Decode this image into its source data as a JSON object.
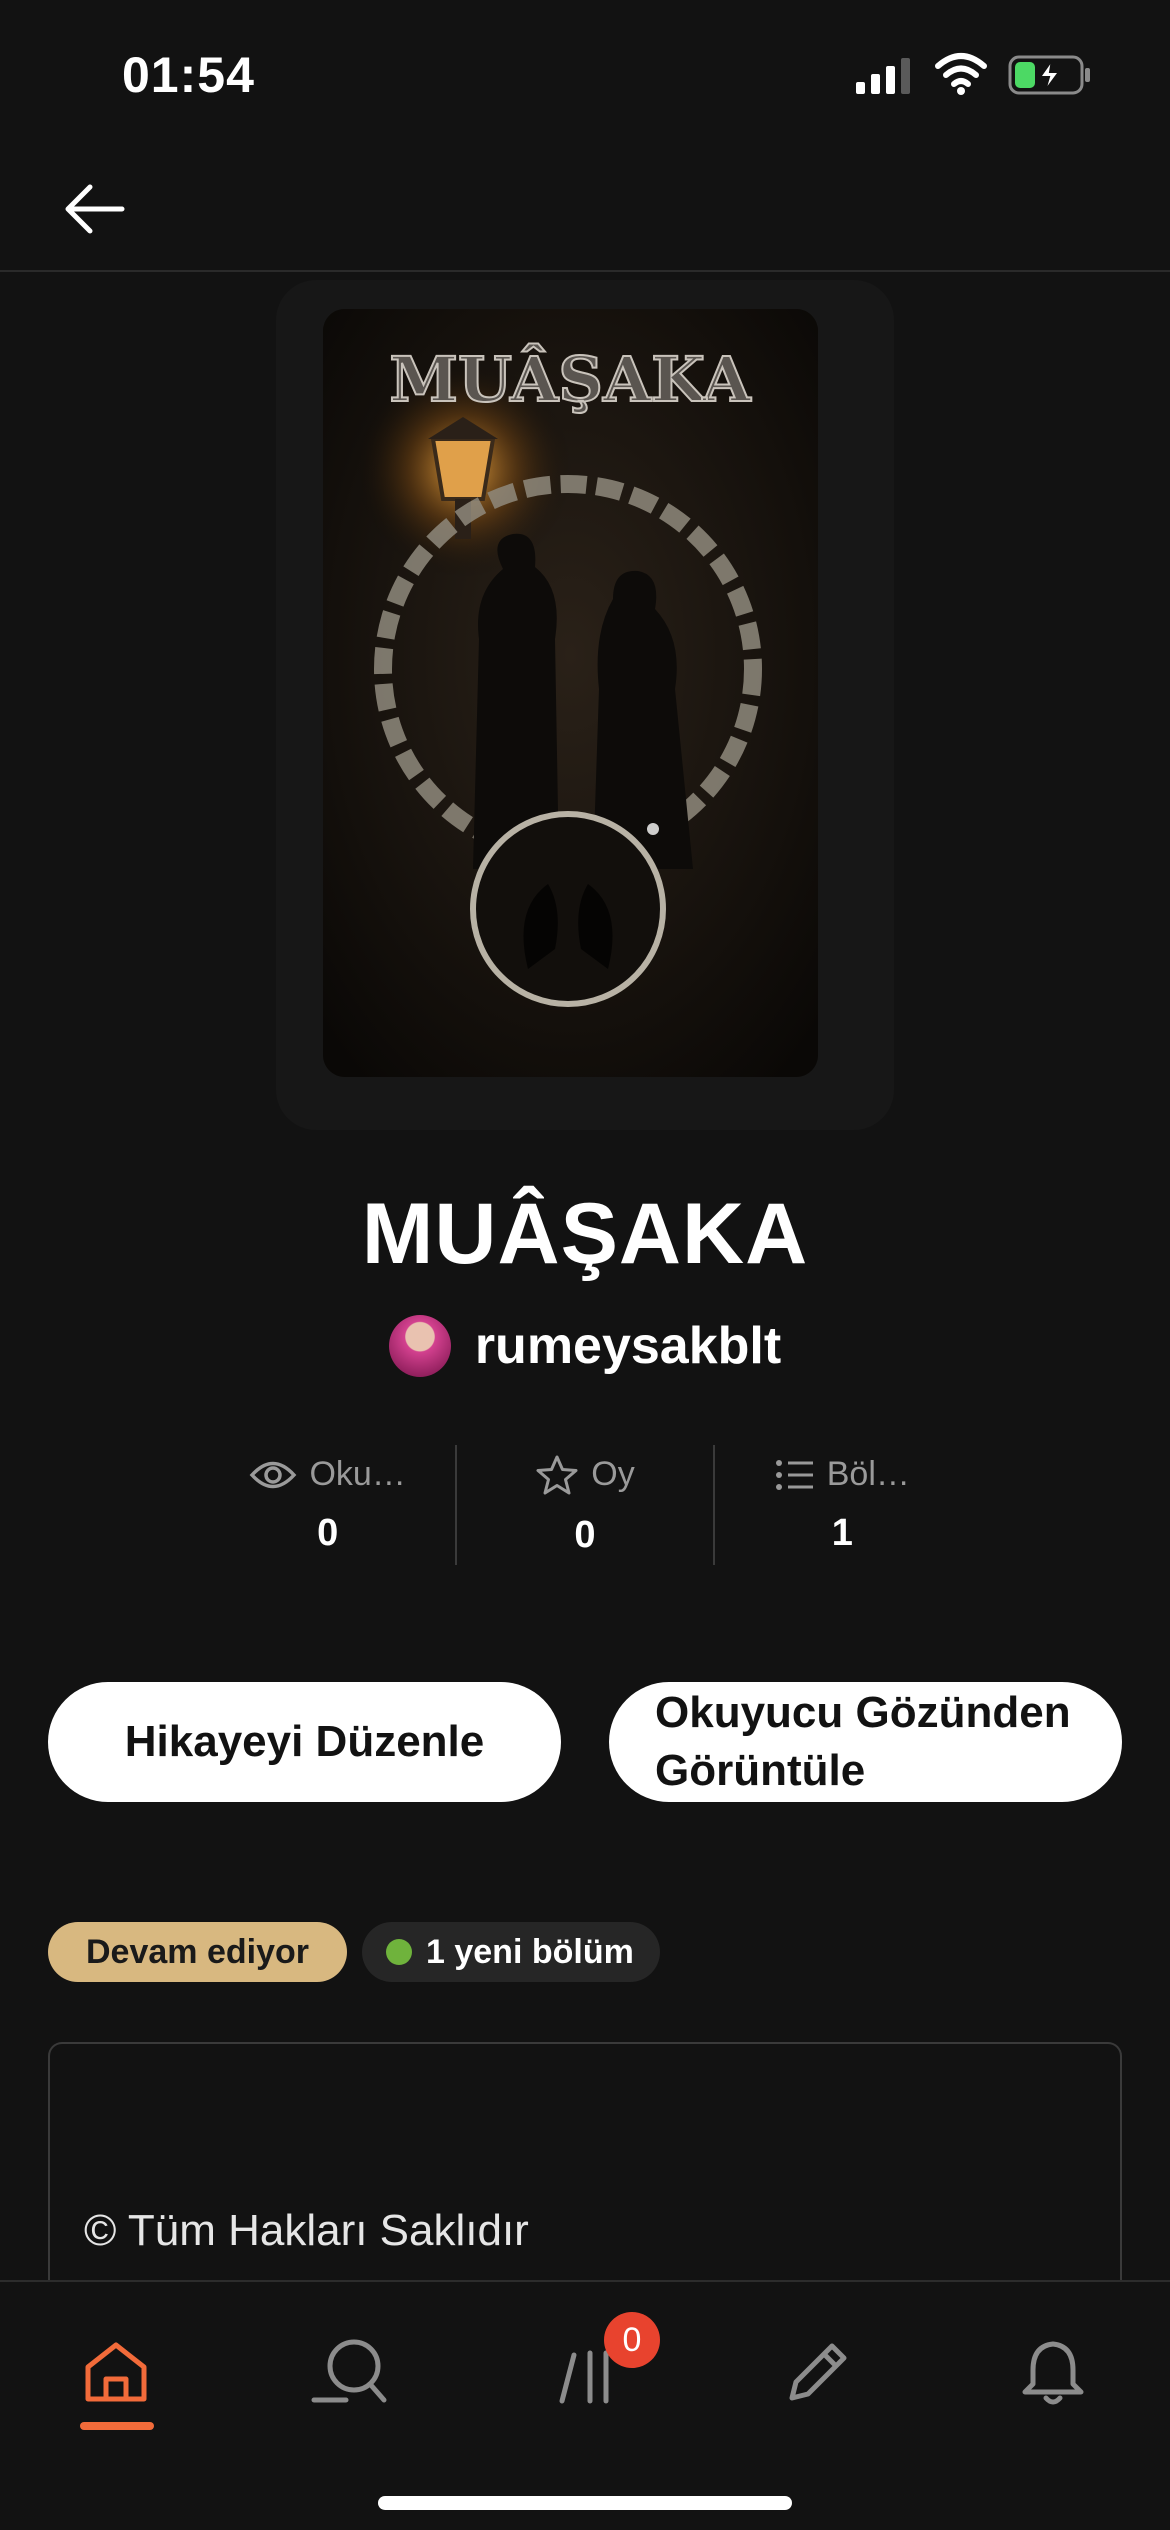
{
  "status_bar": {
    "time": "01:54",
    "icons": [
      "signal-icon",
      "wifi-icon",
      "battery-charging-icon"
    ]
  },
  "nav": {
    "back_icon": "arrow-left-icon"
  },
  "cover": {
    "title_text": "MUÂŞAKA"
  },
  "story": {
    "title": "MUÂŞAKA",
    "author": "rumeysakblt"
  },
  "stats": [
    {
      "label": "Oku…",
      "value": "0",
      "icon": "eye-icon"
    },
    {
      "label": "Oy",
      "value": "0",
      "icon": "star-icon"
    },
    {
      "label": "Böl…",
      "value": "1",
      "icon": "list-icon"
    }
  ],
  "actions": {
    "edit_label": "Hikayeyi Düzenle",
    "preview_label_line1": "Okuyucu Gözünden",
    "preview_label_line2": "Görüntüle"
  },
  "badges": {
    "status": "Devam ediyor",
    "new_parts": "1 yeni bölüm"
  },
  "description": {
    "copyright": "© Tüm Hakları Saklıdır"
  },
  "tab_bar": {
    "active": "home",
    "library_badge": "0",
    "tabs": [
      "home-icon",
      "search-icon",
      "library-icon",
      "write-icon",
      "bell-icon"
    ]
  },
  "colors": {
    "background": "#121212",
    "accent": "#f26b3a",
    "status_badge": "#d8b880",
    "notification_badge": "#e8432e",
    "new_dot": "#6fb33c"
  }
}
